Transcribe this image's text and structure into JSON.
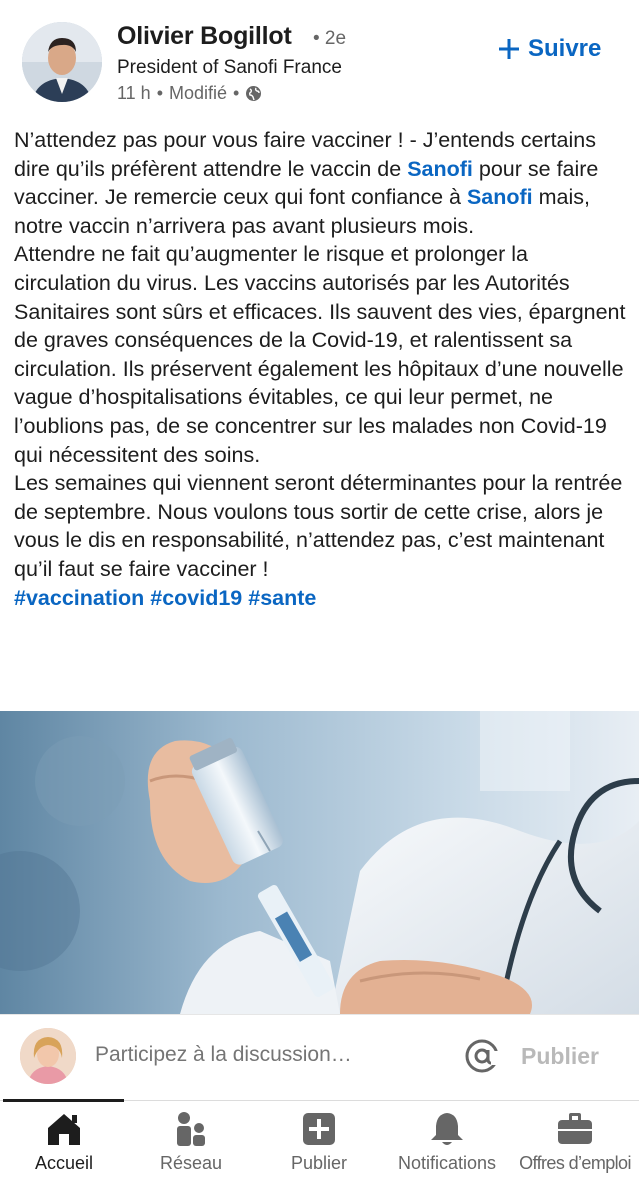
{
  "author": {
    "name": "Olivier Bogillot",
    "degree": "• 2e",
    "headline": "President of Sanofi France",
    "time": "11 h",
    "separator1": "•",
    "edited": "Modifié",
    "separator2": "•"
  },
  "follow": {
    "label": "Suivre"
  },
  "post": {
    "p1_a": "N’attendez pas pour vous faire vacciner ! - J’entends certains dire qu’ils préfèrent attendre le vaccin de ",
    "p1_link1": "Sanofi",
    "p1_b": " pour se faire vacciner. Je remercie ceux qui font confiance à ",
    "p1_link2": "Sanofi",
    "p1_c": " mais, notre vaccin n’arrivera pas avant plusieurs mois.",
    "p2": "Attendre ne fait qu’augmenter le risque et prolonger la circulation du virus. Les vaccins autorisés par les Autorités Sanitaires sont sûrs et efficaces. Ils sauvent des vies, épargnent de graves conséquences de la Covid-19, et ralentissent sa circulation. Ils préservent également les hôpitaux d’une nouvelle vague d’hospitalisations évitables, ce qui leur permet, ne l’oublions pas, de se concentrer sur les malades non Covid-19 qui nécessitent des soins.",
    "p3": "Les semaines qui viennent seront déterminantes pour la rentrée de septembre. Nous voulons tous sortir de cette crise, alors je vous le dis en responsabilité, n’attendez pas, c’est maintenant qu’il faut se faire vacciner !",
    "hashtags": [
      "#vaccination",
      "#covid19",
      "#sante"
    ]
  },
  "comment": {
    "placeholder": "Participez à la discussion…",
    "publish_label": "Publier"
  },
  "nav": {
    "items": [
      {
        "label": "Accueil",
        "icon": "home-icon"
      },
      {
        "label": "Réseau",
        "icon": "network-icon"
      },
      {
        "label": "Publier",
        "icon": "post-icon"
      },
      {
        "label": "Notifications",
        "icon": "bell-icon"
      },
      {
        "label": "Offres d’emploi",
        "icon": "briefcase-icon"
      }
    ],
    "active": "Accueil"
  },
  "colors": {
    "accent": "#0a66c2",
    "text": "#1d1d1d",
    "muted": "#666666"
  }
}
